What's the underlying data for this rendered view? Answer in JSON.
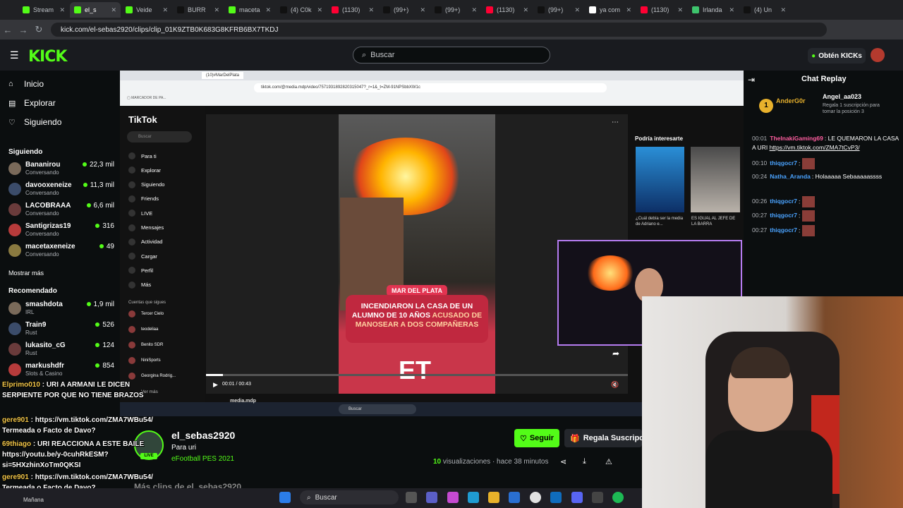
{
  "browser": {
    "tabs": [
      "Stream",
      "el_s",
      "Veide",
      "BURR",
      "maceta",
      "(4) C0k",
      "(1130)",
      "(99+)",
      "(99+)",
      "(1130)",
      "(99+)",
      "ya com",
      "(1130)",
      "Irlanda",
      "(4) Un"
    ],
    "url": "kick.com/el-sebas2920/clips/clip_01K9ZTB0K683G8KFRB6BX7TKDJ"
  },
  "header": {
    "logo": "KICK",
    "search_placeholder": "Buscar",
    "kicks_button": "Obtén KICKs"
  },
  "sidebar": {
    "nav": [
      "Inicio",
      "Explorar",
      "Siguiendo"
    ],
    "following_title": "Siguiendo",
    "following": [
      {
        "name": "Bananirou",
        "category": "Conversando",
        "viewers": "22,3 mil"
      },
      {
        "name": "davooxeneize",
        "category": "Conversando",
        "viewers": "11,3 mil"
      },
      {
        "name": "LACOBRAAA",
        "category": "Conversando",
        "viewers": "6,6 mil"
      },
      {
        "name": "Santigrizas19",
        "category": "Conversando",
        "viewers": "316"
      },
      {
        "name": "macetaxeneize",
        "category": "Conversando",
        "viewers": "49"
      }
    ],
    "show_more": "Mostrar más",
    "recommended_title": "Recomendado",
    "recommended": [
      {
        "name": "smashdota",
        "category": "IRL",
        "viewers": "1,9 mil"
      },
      {
        "name": "Train9",
        "category": "Rust",
        "viewers": "526"
      },
      {
        "name": "lukasito_cG",
        "category": "Rust",
        "viewers": "124"
      },
      {
        "name": "markushdfr",
        "category": "Slots & Casino",
        "viewers": "854"
      }
    ]
  },
  "video": {
    "inner_url": "tiktok.com/@media.mdp/video/7571931892820315047?_r=1&_t=ZM-91NPSbbXW1c",
    "tiktok_logo": "TikTok",
    "tiktok_search": "Buscar",
    "tiktok_nav": [
      "Para ti",
      "Explorar",
      "Siguiendo",
      "Friends",
      "LIVE",
      "Mensajes",
      "Actividad",
      "Cargar",
      "Perfil",
      "Más"
    ],
    "following_accounts_title": "Cuentas que sigues",
    "following_accounts": [
      "Tercer Cielo",
      "teodeliaa",
      "Benito SDR",
      "NiniSports",
      "Georgina Rodrig..."
    ],
    "see_more": "Ver más",
    "banner_tag": "MAR DEL PLATA",
    "banner_line1": "INCENDIARON LA CASA DE UN",
    "banner_line2": "ALUMNO DE 10 AÑOS",
    "banner_highlight": "ACUSADO DE",
    "banner_line3": "MANOSEAR A DOS COMPAÑERAS",
    "clip_logo": "ET",
    "time": "00:01 / 00:43",
    "suggest_title": "Podría interesarte",
    "suggest_caps": [
      "¿Cuál debía ser la media de Adriano e...",
      "ES IGUAL AL JEFE DE LA BARRA"
    ],
    "author": "media.mdp",
    "taskbar_search": "Buscar"
  },
  "channel": {
    "name": "el_sebas2920",
    "title": "Para uri",
    "game": "eFootball PES 2021",
    "live": "LIVE",
    "follow": "Seguir",
    "gift": "Regala Suscripción",
    "views_count": "10",
    "views_label": "visualizaciones",
    "time_ago": "· hace 38 minutos",
    "more_clips": "Más clips de el_sebas2920"
  },
  "chat": {
    "title": "Chat Replay",
    "pinned_user1": "AnderG0r",
    "pinned_user2": "Angel_aa023",
    "pinned_text": "Regala 1 suscripción para tomar la posición 3",
    "messages": [
      {
        "time": "00:01",
        "user": "TheInakiGaming69",
        "text": "LE QUEMARON LA CASA A URI",
        "link": "https://vm.tiktok.com/ZMA7tCvP3/",
        "color": "#ff5ea0"
      },
      {
        "time": "00:10",
        "user": "thiqgocr7",
        "text": "",
        "link": "",
        "color": "#4aa3ff"
      },
      {
        "time": "00:24",
        "user": "Natha_Aranda",
        "text": "Holaaaaa Sebaaaaassss",
        "link": "",
        "color": "#4aa3ff"
      },
      {
        "time": "00:26",
        "user": "thiqgocr7",
        "text": "",
        "link": "",
        "color": "#4aa3ff"
      },
      {
        "time": "00:27",
        "user": "thiqgocr7",
        "text": "",
        "link": "",
        "color": "#4aa3ff"
      },
      {
        "time": "00:27",
        "user": "thiqgocr7",
        "text": "",
        "link": "",
        "color": "#4aa3ff"
      }
    ]
  },
  "overlay_chat": [
    {
      "user": "Elprimo010",
      "text": "URI A ARMANI LE DICEN"
    },
    {
      "user": "",
      "text": "SERPIENTE POR QUE NO TIENE BRAZOS"
    },
    {
      "user": "gere901",
      "text": "https://vm.tiktok.com/ZMA7WBu54/"
    },
    {
      "user": "",
      "text": "Termeada o Facto de Davo?"
    },
    {
      "user": "69thiago",
      "text": "URI REACCIONA A ESTE BAILE"
    },
    {
      "user": "",
      "text": "https://youtu.be/y-0cuhRkESM?"
    },
    {
      "user": "",
      "text": "si=5HXzhinXoTm0QKSI"
    },
    {
      "user": "gere901",
      "text": "https://vm.tiktok.com/ZMA7WBu54/"
    },
    {
      "user": "",
      "text": "Termeada o Facto de Davo?"
    }
  ],
  "taskbar": {
    "search": "Buscar",
    "weather": "Mañana"
  },
  "colors": {
    "accent": "#53fc18",
    "bg": "#0b0e0f",
    "panel": "#191b1f"
  }
}
